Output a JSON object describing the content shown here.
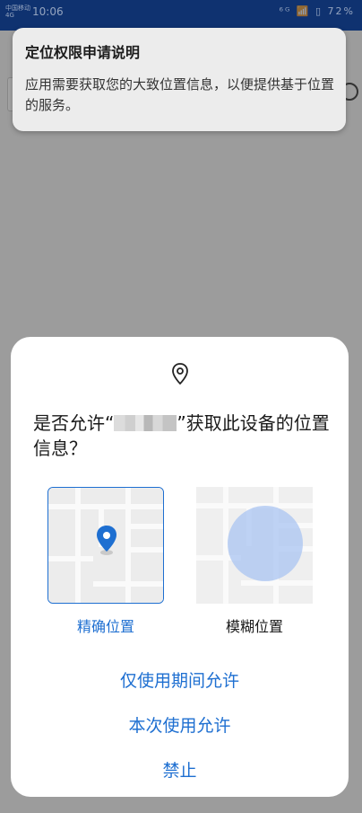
{
  "status_bar": {
    "carrier": "中国移动 4G",
    "time": "10:06",
    "indicators": "⁶ᴳ 📶 ▯ 72%"
  },
  "info_card": {
    "title": "定位权限申请说明",
    "body": "应用需要获取您的大致位置信息，以便提供基于位置的服务。"
  },
  "dialog": {
    "question_prefix": "是否允许“",
    "question_suffix": "”获取此设备的位置信息？",
    "options": [
      {
        "label": "精确位置",
        "selected": true
      },
      {
        "label": "模糊位置",
        "selected": false
      }
    ],
    "actions": [
      "仅使用期间允许",
      "本次使用允许",
      "禁止"
    ]
  },
  "colors": {
    "accent": "#1e6fd1",
    "scrim": "#9b9b9b",
    "header": "#0f3270"
  },
  "icons": {
    "dialog_top": "location-pin-outline-icon",
    "precise_marker": "location-pin-icon",
    "approx_marker": "approx-area-circle-icon"
  }
}
